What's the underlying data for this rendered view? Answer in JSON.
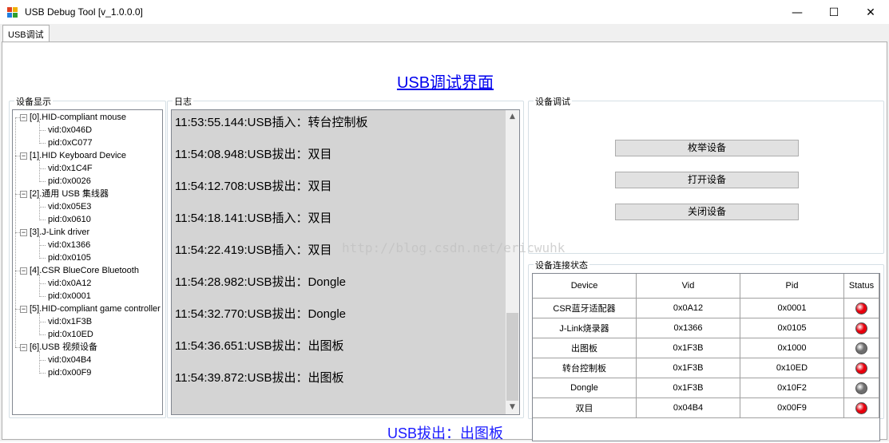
{
  "window": {
    "title": "USB Debug Tool [v_1.0.0.0]",
    "minimize": "—",
    "maximize": "☐",
    "close": "✕"
  },
  "tabs": [
    {
      "label": "USB调试"
    }
  ],
  "heading": "USB调试界面",
  "device_group": {
    "label": "设备显示",
    "nodes": [
      {
        "label": "[0].HID-compliant mouse",
        "vid": "vid:0x046D",
        "pid": "pid:0xC077"
      },
      {
        "label": "[1].HID Keyboard Device",
        "vid": "vid:0x1C4F",
        "pid": "pid:0x0026"
      },
      {
        "label": "[2].通用 USB 集线器",
        "vid": "vid:0x05E3",
        "pid": "pid:0x0610"
      },
      {
        "label": "[3].J-Link driver",
        "vid": "vid:0x1366",
        "pid": "pid:0x0105"
      },
      {
        "label": "[4].CSR BlueCore Bluetooth",
        "vid": "vid:0x0A12",
        "pid": "pid:0x0001"
      },
      {
        "label": "[5].HID-compliant game controller",
        "vid": "vid:0x1F3B",
        "pid": "pid:0x10ED"
      },
      {
        "label": "[6].USB 视频设备",
        "vid": "vid:0x04B4",
        "pid": "pid:0x00F9"
      }
    ],
    "expand_glyph": "−"
  },
  "log_group": {
    "label": "日志",
    "lines": [
      "11:53:55.144:USB插入：转台控制板",
      "11:54:08.948:USB拔出：双目",
      "11:54:12.708:USB拔出：双目",
      "11:54:18.141:USB插入：双目",
      "11:54:22.419:USB插入：双目",
      "11:54:28.982:USB拔出：Dongle",
      "11:54:32.770:USB拔出：Dongle",
      "11:54:36.651:USB拔出：出图板",
      "11:54:39.872:USB拔出：出图板"
    ],
    "watermark": "http://blog.csdn.net/ericwuhk",
    "scroll_up": "▲",
    "scroll_down": "▼"
  },
  "debug_group": {
    "label": "设备调试",
    "buttons": {
      "enumerate": "枚举设备",
      "open": "打开设备",
      "close": "关闭设备"
    }
  },
  "status_group": {
    "label": "设备连接状态",
    "columns": [
      "Device",
      "Vid",
      "Pid",
      "Status"
    ],
    "rows": [
      {
        "device": "CSR蓝牙适配器",
        "vid": "0x0A12",
        "pid": "0x0001",
        "status": "red"
      },
      {
        "device": "J-Link烧录器",
        "vid": "0x1366",
        "pid": "0x0105",
        "status": "red"
      },
      {
        "device": "出图板",
        "vid": "0x1F3B",
        "pid": "0x1000",
        "status": "gray"
      },
      {
        "device": "转台控制板",
        "vid": "0x1F3B",
        "pid": "0x10ED",
        "status": "red"
      },
      {
        "device": "Dongle",
        "vid": "0x1F3B",
        "pid": "0x10F2",
        "status": "gray"
      },
      {
        "device": "双目",
        "vid": "0x04B4",
        "pid": "0x00F9",
        "status": "red"
      }
    ]
  },
  "status_message": "USB拔出：出图板",
  "colors": {
    "led_red": "#e8000d",
    "led_gray": "#6e6e6e",
    "link": "#0000ee"
  }
}
